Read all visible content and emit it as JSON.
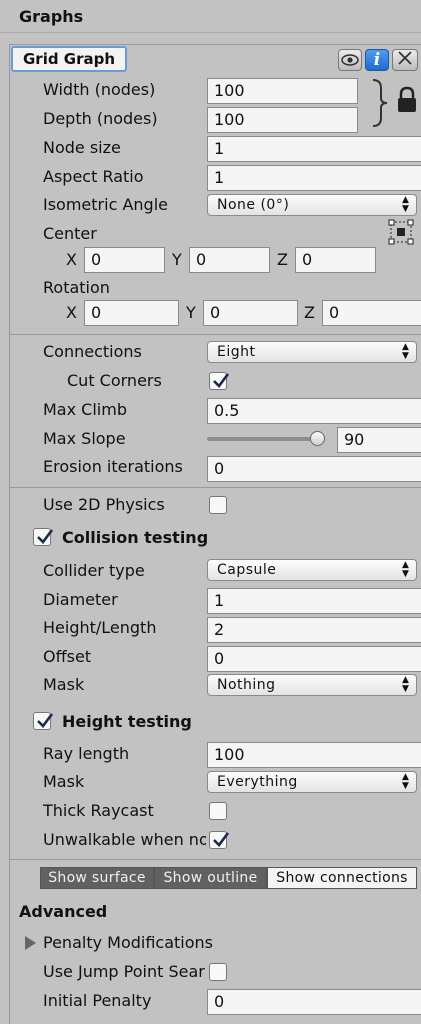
{
  "window_title": "Graphs",
  "graph": {
    "name": "Grid Graph",
    "width_label": "Width (nodes)",
    "width": "100",
    "depth_label": "Depth (nodes)",
    "depth": "100",
    "node_size_label": "Node size",
    "node_size": "1",
    "aspect_ratio_label": "Aspect Ratio",
    "aspect_ratio": "1",
    "isometric_label": "Isometric Angle",
    "isometric": "None (0°)",
    "center_label": "Center",
    "center": {
      "x_label": "X",
      "x": "0",
      "y_label": "Y",
      "y": "0",
      "z_label": "Z",
      "z": "0"
    },
    "rotation_label": "Rotation",
    "rotation": {
      "x_label": "X",
      "x": "0",
      "y_label": "Y",
      "y": "0",
      "z_label": "Z",
      "z": "0"
    }
  },
  "connections": {
    "connections_label": "Connections",
    "connections": "Eight",
    "cut_corners_label": "Cut Corners",
    "cut_corners": true,
    "max_climb_label": "Max Climb",
    "max_climb": "0.5",
    "max_slope_label": "Max Slope",
    "max_slope": "90",
    "max_slope_fraction": 1.0,
    "erosion_label": "Erosion iterations",
    "erosion": "0"
  },
  "physics": {
    "use_2d_label": "Use 2D Physics",
    "use_2d": false
  },
  "collision": {
    "header": "Collision testing",
    "enabled": true,
    "collider_type_label": "Collider type",
    "collider_type": "Capsule",
    "diameter_label": "Diameter",
    "diameter": "1",
    "height_label": "Height/Length",
    "height": "2",
    "offset_label": "Offset",
    "offset": "0",
    "mask_label": "Mask",
    "mask": "Nothing"
  },
  "height_testing": {
    "header": "Height testing",
    "enabled": true,
    "ray_length_label": "Ray length",
    "ray_length": "100",
    "mask_label": "Mask",
    "mask": "Everything",
    "thick_raycast_label": "Thick Raycast",
    "thick_raycast": false,
    "unwalkable_label": "Unwalkable when no ground",
    "unwalkable": true
  },
  "toolbar": {
    "show_surface": "Show surface",
    "show_outline": "Show outline",
    "show_connections": "Show connections"
  },
  "advanced": {
    "header": "Advanced",
    "penalty_mods_label": "Penalty Modifications",
    "jump_point_label": "Use Jump Point Search",
    "jump_point": false,
    "initial_penalty_label": "Initial Penalty",
    "initial_penalty": "0"
  }
}
